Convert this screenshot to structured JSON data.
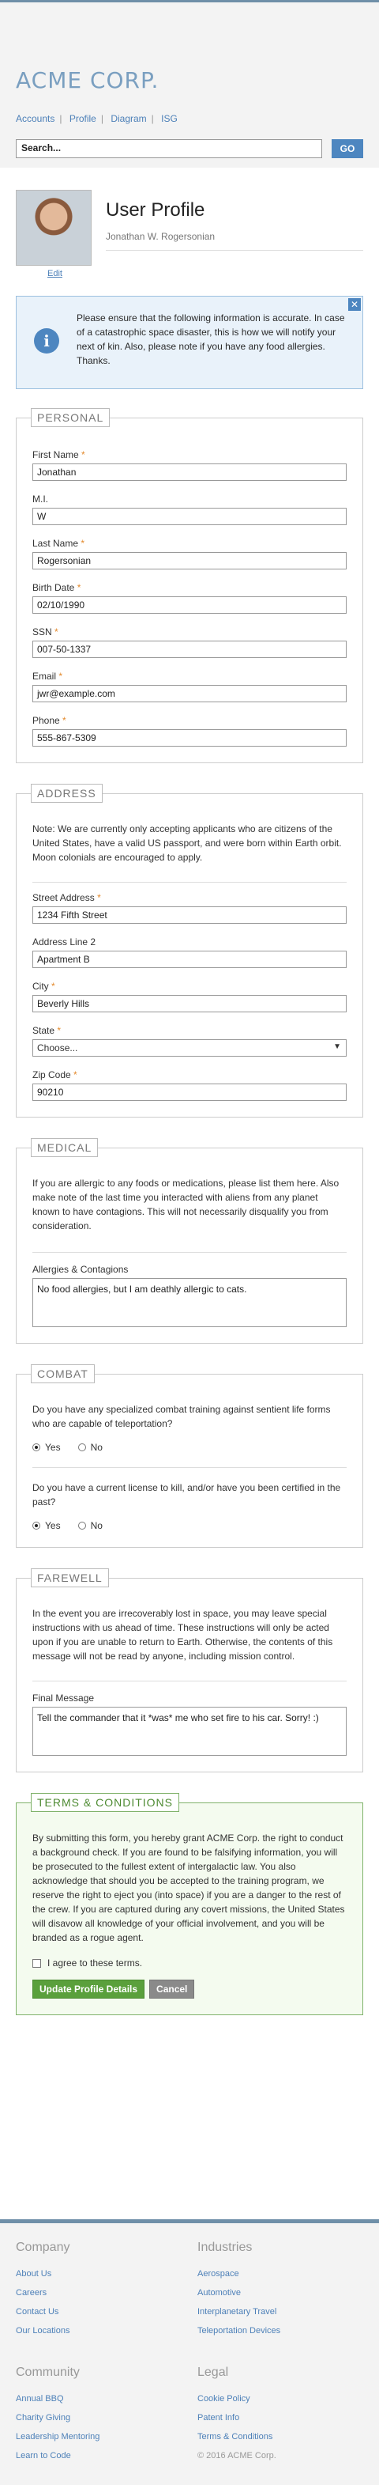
{
  "header": {
    "logo": "ACME CORP.",
    "nav": [
      "Accounts",
      "Profile",
      "Diagram",
      "ISG"
    ],
    "search_placeholder": "Search...",
    "go_label": "GO"
  },
  "profile": {
    "edit_label": "Edit",
    "title": "User Profile",
    "name": "Jonathan W. Rogersonian"
  },
  "notice": {
    "icon": "i",
    "close": "✕",
    "text": "Please ensure that the following information is accurate. In case of a catastrophic space disaster, this is how we will notify your next of kin. Also, please note if you have any food allergies. Thanks."
  },
  "personal": {
    "legend": "PERSONAL",
    "first_name": {
      "label": "First Name",
      "value": "Jonathan"
    },
    "mi": {
      "label": "M.I.",
      "value": "W"
    },
    "last_name": {
      "label": "Last Name",
      "value": "Rogersonian"
    },
    "birth_date": {
      "label": "Birth Date",
      "value": "02/10/1990"
    },
    "ssn": {
      "label": "SSN",
      "value": "007-50-1337"
    },
    "email": {
      "label": "Email",
      "value": "jwr@example.com"
    },
    "phone": {
      "label": "Phone",
      "value": "555-867-5309"
    }
  },
  "address": {
    "legend": "ADDRESS",
    "note": "Note: We are currently only accepting applicants who are citizens of the United States, have a valid US passport, and were born within Earth orbit. Moon colonials are encouraged to apply.",
    "street": {
      "label": "Street Address",
      "value": "1234 Fifth Street"
    },
    "line2": {
      "label": "Address Line 2",
      "value": "Apartment B"
    },
    "city": {
      "label": "City",
      "value": "Beverly Hills"
    },
    "state": {
      "label": "State",
      "value": "Choose..."
    },
    "zip": {
      "label": "Zip Code",
      "value": "90210"
    }
  },
  "medical": {
    "legend": "MEDICAL",
    "note": "If you are allergic to any foods or medications, please list them here. Also make note of the last time you interacted with aliens from any planet known to have contagions. This will not necessarily disqualify you from consideration.",
    "allergies": {
      "label": "Allergies & Contagions",
      "value": "No food allergies, but I am deathly allergic to cats."
    }
  },
  "combat": {
    "legend": "COMBAT",
    "q1": "Do you have any specialized combat training against sentient life forms who are capable of teleportation?",
    "q2": "Do you have a current license to kill, and/or have you been certified in the past?",
    "yes": "Yes",
    "no": "No"
  },
  "farewell": {
    "legend": "FAREWELL",
    "note": "In the event you are irrecoverably lost in space, you may leave special instructions with us ahead of time. These instructions will only be acted upon if you are unable to return to Earth. Otherwise, the contents of this message will not be read by anyone, including mission control.",
    "message": {
      "label": "Final Message",
      "value": "Tell the commander that it *was* me who set fire to his car. Sorry! :)"
    }
  },
  "terms": {
    "legend": "TERMS & CONDITIONS",
    "text": "By submitting this form, you hereby grant ACME Corp. the right to conduct a background check. If you are found to be falsifying information, you will be prosecuted to the fullest extent of intergalactic law. You also acknowledge that should you be accepted to the training program, we reserve the right to eject you (into space) if you are a danger to the rest of the crew. If you are captured during any covert missions, the United States will disavow all knowledge of your official involvement, and you will be branded as a rogue agent.",
    "agree": "I agree to these terms.",
    "submit": "Update Profile Details",
    "cancel": "Cancel"
  },
  "footer": {
    "company": {
      "title": "Company",
      "links": [
        "About Us",
        "Careers",
        "Contact Us",
        "Our Locations"
      ]
    },
    "industries": {
      "title": "Industries",
      "links": [
        "Aerospace",
        "Automotive",
        "Interplanetary Travel",
        "Teleportation Devices"
      ]
    },
    "community": {
      "title": "Community",
      "links": [
        "Annual BBQ",
        "Charity Giving",
        "Leadership Mentoring",
        "Learn to Code"
      ]
    },
    "legal": {
      "title": "Legal",
      "links": [
        "Cookie Policy",
        "Patent Info",
        "Terms & Conditions"
      ],
      "copyright": "© 2016 ACME Corp."
    }
  },
  "colors": {
    "accent": "#4d86c0",
    "brand": "#7a9fc0",
    "success": "#5aa03c",
    "required": "#e38a2d"
  }
}
